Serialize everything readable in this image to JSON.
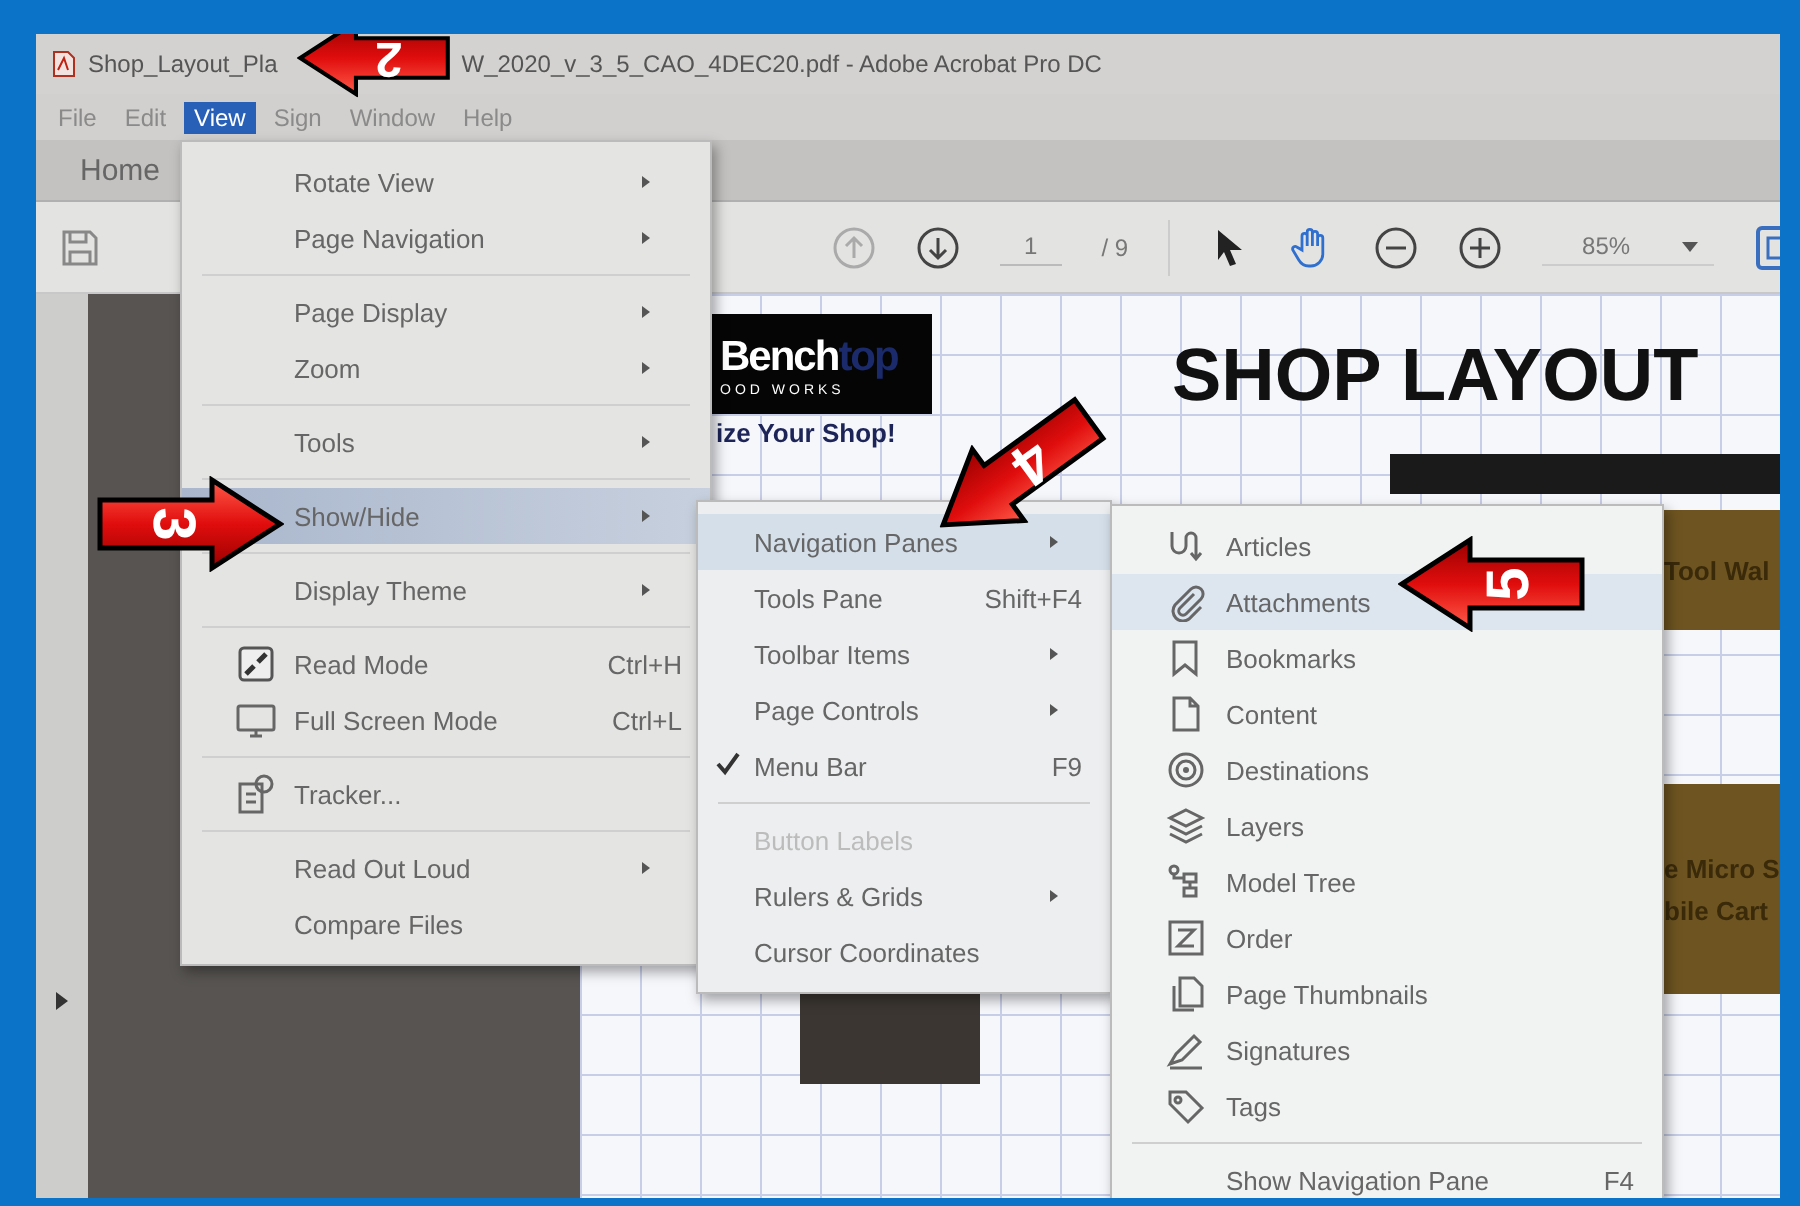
{
  "window": {
    "title_start": "Shop_Layout_Pla",
    "title_end": "W_2020_v_3_5_CAO_4DEC20.pdf - Adobe Acrobat Pro DC"
  },
  "menu_bar": [
    {
      "label": "File",
      "selected": false
    },
    {
      "label": "Edit",
      "selected": false
    },
    {
      "label": "View",
      "selected": true
    },
    {
      "label": "Sign",
      "selected": false
    },
    {
      "label": "Window",
      "selected": false
    },
    {
      "label": "Help",
      "selected": false
    }
  ],
  "tabs": [
    {
      "label": "Home"
    }
  ],
  "toolbar": {
    "page_number": "1",
    "page_total": "/ 9",
    "zoom": "85%",
    "tools": [
      {
        "selected": false
      },
      {
        "selected": true
      }
    ]
  },
  "document": {
    "logo_text": "Bench",
    "logo_text_accent": "top",
    "logo_subtitle": "OOD WORKS",
    "tagline": "ize Your Shop!",
    "heading": "SHOP LAYOUT",
    "labels": [
      "Tool Wal",
      "e Micro S",
      "bile Cart"
    ]
  },
  "view_menu": {
    "groups": [
      [
        {
          "label": "Rotate View",
          "has_submenu": true,
          "selected": false
        },
        {
          "label": "Page Navigation",
          "has_submenu": true,
          "selected": false
        }
      ],
      [
        {
          "label": "Page Display",
          "has_submenu": true,
          "selected": false
        },
        {
          "label": "Zoom",
          "has_submenu": true,
          "selected": false
        }
      ],
      [
        {
          "label": "Tools",
          "has_submenu": true,
          "selected": false
        }
      ],
      [
        {
          "label": "Show/Hide",
          "has_submenu": true,
          "selected": true
        }
      ],
      [
        {
          "label": "Display Theme",
          "has_submenu": true,
          "selected": false
        }
      ],
      [
        {
          "label": "Read Mode",
          "shortcut": "Ctrl+H",
          "has_submenu": false,
          "selected": false
        },
        {
          "label": "Full Screen Mode",
          "shortcut": "Ctrl+L",
          "has_submenu": false,
          "selected": false
        }
      ],
      [
        {
          "label": "Tracker...",
          "has_submenu": false,
          "selected": false
        }
      ],
      [
        {
          "label": "Read Out Loud",
          "has_submenu": true,
          "selected": false
        },
        {
          "label": "Compare Files",
          "has_submenu": false,
          "selected": false
        }
      ]
    ]
  },
  "show_hide_menu": {
    "groups": [
      [
        {
          "label": "Navigation Panes",
          "has_submenu": true,
          "selected": true,
          "checked": false,
          "disabled": false
        },
        {
          "label": "Tools Pane",
          "shortcut": "Shift+F4",
          "has_submenu": false,
          "selected": false,
          "checked": false,
          "disabled": false
        },
        {
          "label": "Toolbar Items",
          "has_submenu": true,
          "selected": false,
          "checked": false,
          "disabled": false
        },
        {
          "label": "Page Controls",
          "has_submenu": true,
          "selected": false,
          "checked": false,
          "disabled": false
        },
        {
          "label": "Menu Bar",
          "shortcut": "F9",
          "has_submenu": false,
          "selected": false,
          "checked": true,
          "disabled": false
        }
      ],
      [
        {
          "label": "Button Labels",
          "has_submenu": false,
          "selected": false,
          "checked": false,
          "disabled": true
        },
        {
          "label": "Rulers & Grids",
          "has_submenu": true,
          "selected": false,
          "checked": false,
          "disabled": false
        },
        {
          "label": "Cursor Coordinates",
          "has_submenu": false,
          "selected": false,
          "checked": false,
          "disabled": false
        }
      ]
    ]
  },
  "navigation_panes_menu": {
    "groups": [
      [
        {
          "label": "Articles",
          "selected": false
        },
        {
          "label": "Attachments",
          "selected": true
        },
        {
          "label": "Bookmarks",
          "selected": false
        },
        {
          "label": "Content",
          "selected": false
        },
        {
          "label": "Destinations",
          "selected": false
        },
        {
          "label": "Layers",
          "selected": false
        },
        {
          "label": "Model Tree",
          "selected": false
        },
        {
          "label": "Order",
          "selected": false
        },
        {
          "label": "Page Thumbnails",
          "selected": false
        },
        {
          "label": "Signatures",
          "selected": false
        },
        {
          "label": "Tags",
          "selected": false
        }
      ],
      [
        {
          "label": "Show Navigation Pane",
          "shortcut": "F4",
          "selected": false
        }
      ]
    ]
  },
  "callouts": [
    {
      "number": "2"
    },
    {
      "number": "3"
    },
    {
      "number": "4"
    },
    {
      "number": "5"
    }
  ]
}
